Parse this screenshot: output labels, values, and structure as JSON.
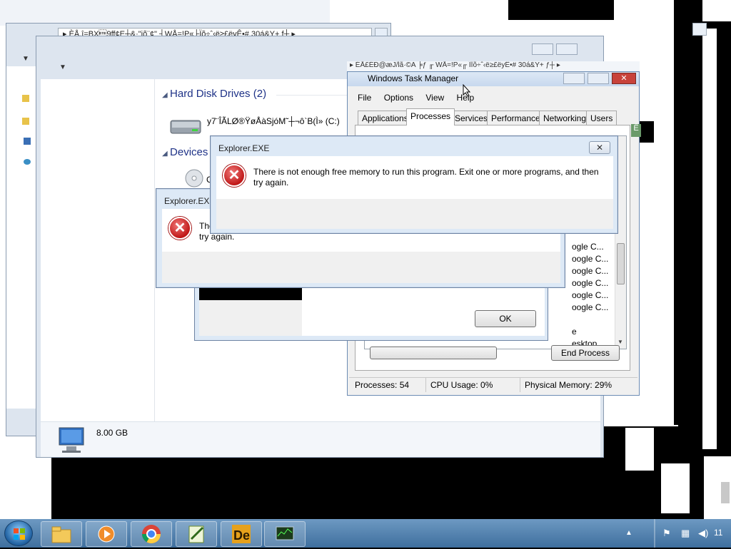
{
  "explorer_back": {
    "address": "▸ ÈÅ.î=BX\u00179ff¢E┼&·\"iõ¨¢\" ┤WÅ=!P«├Ïõ÷ˆ‹ë≥£ëyÊ•# 30á&Y+ f┼ ▸"
  },
  "explorer_front": {
    "address": "▸ ÉÅ£ÉÐ@æJ/lã·©A ╞ƒ ╓ WÅ=!P«╓ ÎÏõ÷ˆ‹ë≥£ëyÊ•# 30á&Y+ ƒ┼ ▸",
    "group_hard_disks": "Hard Disk Drives (2)",
    "drive_name": "y7¨ÎÃLØ®ŸøÅàSjóM˜┼¬ô`B(Ì» (C:)",
    "group_devices": "Devices",
    "device_letter": "C",
    "memory_label": "8.00 GB"
  },
  "task_manager": {
    "title": "Windows Task Manager",
    "menu": [
      "File",
      "Options",
      "View",
      "Help"
    ],
    "tabs": [
      "Applications",
      "Processes",
      "Services",
      "Performance",
      "Networking",
      "Users"
    ],
    "active_tab": "Processes",
    "process_rows": [
      "ogle C...",
      "oogle C...",
      "oogle C...",
      "oogle C...",
      "oogle C...",
      "oogle C...",
      "",
      "e",
      "esktop ..."
    ],
    "end_process_label": "End Process",
    "status": {
      "processes": "Processes: 54",
      "cpu": "CPU Usage: 0%",
      "memory": "Physical Memory: 29%"
    },
    "side_glyph": "Ê"
  },
  "dialog_back": {
    "title": "Explorer.EXE",
    "message_visible": "The",
    "message_line2": "try again.",
    "ok_label": "OK"
  },
  "dialog_front": {
    "title": "Explorer.EXE",
    "message": "There is not enough free memory to run this program. Exit one or more programs, and then try again.",
    "close_glyph": "✕"
  },
  "taskbar": {
    "clock": "11",
    "apps": [
      "windows-explorer",
      "media-player",
      "chrome",
      "notepad-plus-plus",
      "de-app",
      "task-manager"
    ]
  },
  "icons": {
    "error": "error-icon",
    "computer": "computer-icon",
    "drive": "hard-drive-icon",
    "dvd": "dvd-drive-icon"
  }
}
